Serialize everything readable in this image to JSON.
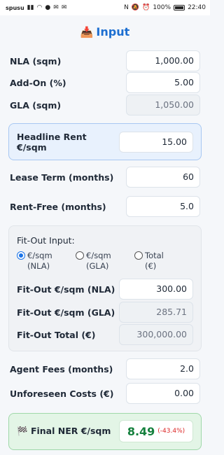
{
  "status_bar": {
    "carrier": "spusu",
    "battery": "100%",
    "time": "22:40"
  },
  "header": {
    "title": "Input",
    "icon": "inbox-tray-icon"
  },
  "fields": {
    "nla": {
      "label": "NLA (sqm)",
      "value": "1,000.00"
    },
    "addon": {
      "label": "Add-On (%)",
      "value": "5.00"
    },
    "gla": {
      "label": "GLA (sqm)",
      "value": "1,050.00"
    },
    "headline_rent": {
      "label": "Headline Rent €/sqm",
      "value": "15.00"
    },
    "lease_term": {
      "label": "Lease Term (months)",
      "value": "60"
    },
    "rent_free": {
      "label": "Rent-Free (months)",
      "value": "5.0"
    }
  },
  "fitout": {
    "title": "Fit-Out Input:",
    "options": [
      {
        "line1": "€/sqm",
        "line2": "(NLA)",
        "selected": true
      },
      {
        "line1": "€/sqm",
        "line2": "(GLA)",
        "selected": false
      },
      {
        "line1": "Total",
        "line2": "(€)",
        "selected": false
      }
    ],
    "nla": {
      "label": "Fit-Out €/sqm (NLA)",
      "value": "300.00"
    },
    "gla": {
      "label": "Fit-Out €/sqm (GLA)",
      "value": "285.71"
    },
    "total": {
      "label": "Fit-Out Total (€)",
      "value": "300,000.00"
    }
  },
  "costs": {
    "agent_fees": {
      "label": "Agent Fees (months)",
      "value": "2.0"
    },
    "unforeseen": {
      "label": "Unforeseen Costs (€)",
      "value": "0.00"
    }
  },
  "final": {
    "label": "Final NER €/sqm",
    "value": "8.49",
    "change": "(-43.4%)",
    "icon": "checkered-flag-icon"
  }
}
